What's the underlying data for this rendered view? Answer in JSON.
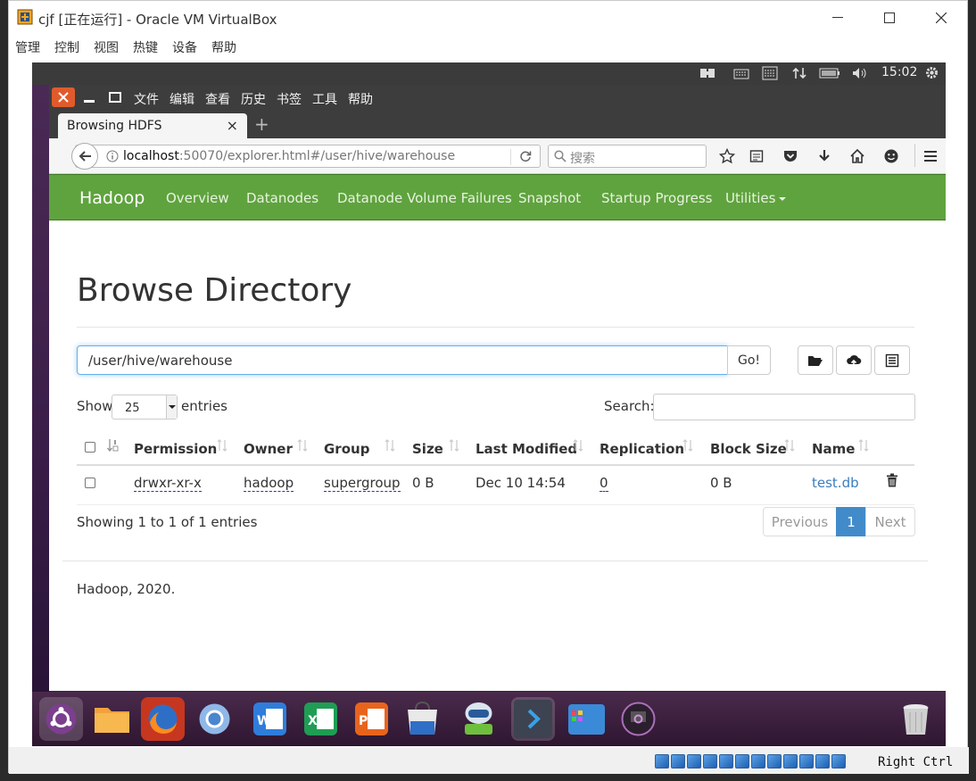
{
  "vbox": {
    "title": "cjf [正在运行] - Oracle VM VirtualBox",
    "menu": [
      "管理",
      "控制",
      "视图",
      "热键",
      "设备",
      "帮助"
    ],
    "status_host_key": "Right Ctrl"
  },
  "ubuntu": {
    "clock": "15:02"
  },
  "firefox": {
    "menu": [
      "文件",
      "编辑",
      "查看",
      "历史",
      "书签",
      "工具",
      "帮助"
    ],
    "tab_title": "Browsing HDFS",
    "tab_close": "×",
    "new_tab": "+",
    "url_host": "localhost",
    "url_path": ":50070/explorer.html#/user/hive/warehouse",
    "search_placeholder": "搜索"
  },
  "hadoop": {
    "brand": "Hadoop",
    "nav": [
      "Overview",
      "Datanodes",
      "Datanode Volume Failures",
      "Snapshot",
      "Startup Progress",
      "Utilities"
    ]
  },
  "page": {
    "title": "Browse Directory",
    "dir_value": "/user/hive/warehouse",
    "go_label": "Go!",
    "show_label": "Show",
    "entries_select": "25",
    "entries_label": "entries",
    "search_label": "Search:",
    "columns": [
      "Permission",
      "Owner",
      "Group",
      "Size",
      "Last Modified",
      "Replication",
      "Block Size",
      "Name"
    ],
    "rows": [
      {
        "permission": "drwxr-xr-x",
        "owner": "hadoop",
        "group": "supergroup",
        "size": "0 B",
        "last_modified": "Dec 10 14:54",
        "replication": "0",
        "block_size": "0 B",
        "name": "test.db"
      }
    ],
    "showing_info": "Showing 1 to 1 of 1 entries",
    "pager": {
      "previous": "Previous",
      "current": "1",
      "next": "Next"
    },
    "footer": "Hadoop, 2020."
  },
  "colors": {
    "hadoop_nav": "#5fa33e",
    "link": "#3a7dbf",
    "pager_active": "#428bca",
    "ff_chrome": "#3d3d3d",
    "close_orange": "#e05b2b"
  },
  "dock_icons": [
    "ubuntu-icon",
    "files-icon",
    "firefox-icon",
    "chromium-icon",
    "word-icon",
    "excel-icon",
    "powerpoint-icon",
    "software-center-icon",
    "robot-icon",
    "terminal-icon",
    "app-grid-icon",
    "media-icon",
    "trash-icon"
  ]
}
